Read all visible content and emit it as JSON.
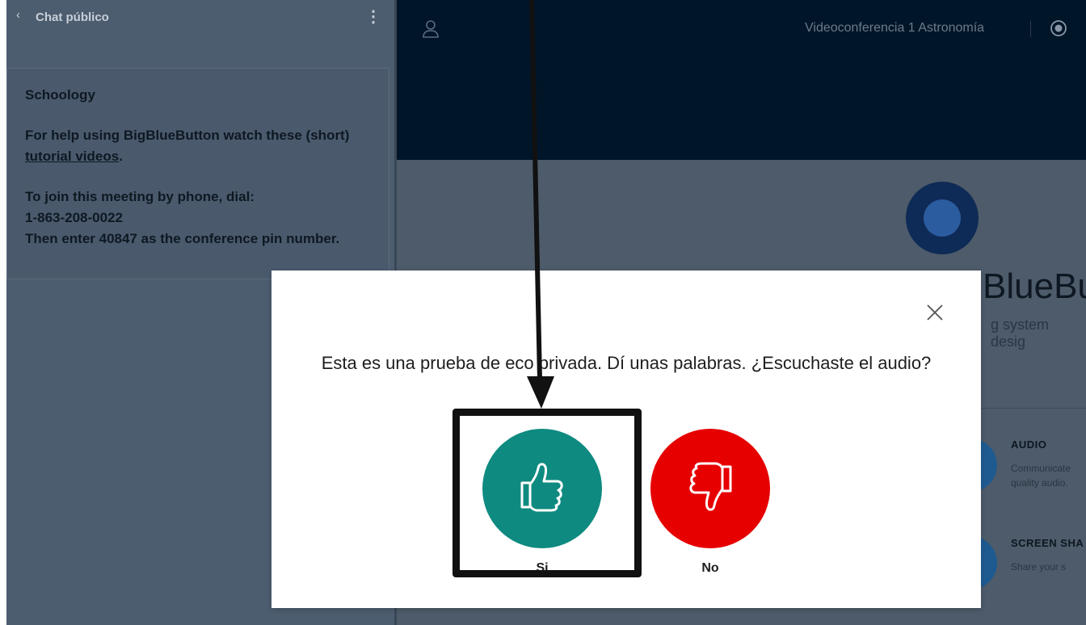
{
  "chat": {
    "back_icon": "‹",
    "title": "Chat público",
    "menu_icon": "⋮"
  },
  "welcome": {
    "heading": "Schoology",
    "help_text": "For help using BigBlueButton watch these (short)",
    "help_link": "tutorial videos",
    "help_suffix": ".",
    "phone_line1": "To join this meeting by phone, dial:",
    "phone_number": "1-863-208-0022",
    "phone_line3": "Then enter 40847 as the conference pin number."
  },
  "topbar": {
    "conference_title": "Videoconferencia 1 Astronomía",
    "user_icon": "user-icon",
    "record_icon": "record-icon"
  },
  "landing": {
    "brand": "BlueBu",
    "subtitle": "g system desig",
    "features": [
      {
        "title": "AUDIO",
        "desc_line1": "Communicate",
        "desc_line2": "quality audio."
      },
      {
        "title": "SCREEN SHA",
        "desc_line1": "Share your s"
      }
    ]
  },
  "modal": {
    "question": "Esta es una prueba de eco privada. Dí unas palabras. ¿Escuchaste el audio?",
    "yes_label": "Si",
    "no_label": "No",
    "close_icon": "close-icon",
    "yes_color": "#0f8a80",
    "no_color": "#e60000"
  }
}
